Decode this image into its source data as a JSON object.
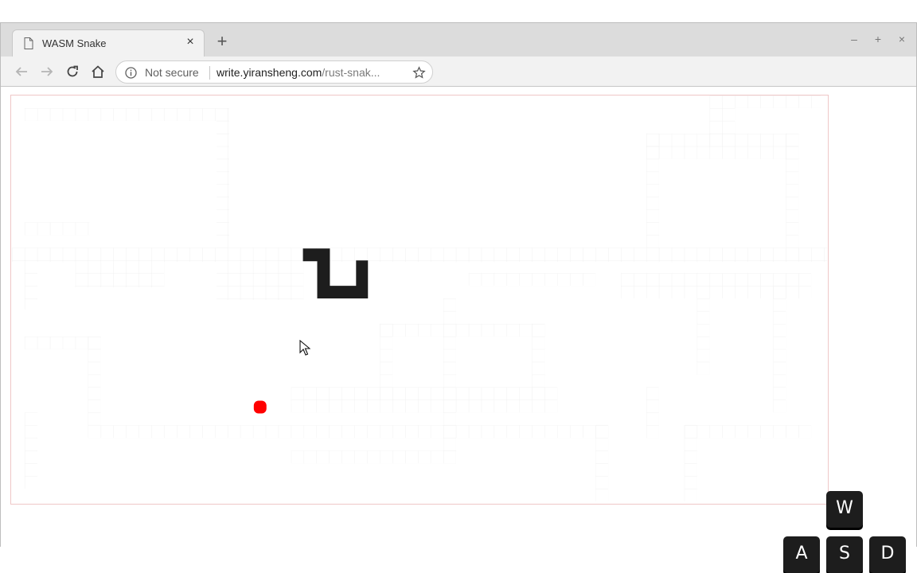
{
  "browser": {
    "tab_title": "WASM Snake",
    "new_tab_symbol": "+",
    "close_symbol": "×",
    "window_controls": {
      "minimize": "–",
      "maximize": "+",
      "close": "×"
    },
    "omnibox": {
      "security_label": "Not secure",
      "url_host": "write.yiransheng.com",
      "url_path": "/rust-snak..."
    },
    "icons": [
      "page-icon",
      "back-arrow-icon",
      "forward-arrow-icon",
      "reload-icon",
      "home-icon",
      "info-icon",
      "star-icon"
    ]
  },
  "game": {
    "board_border_color": "#efc7c7",
    "snake_color": "#1d1d1d",
    "food_color": "#ff0000",
    "controls": {
      "up": "W",
      "left": "A",
      "down": "S",
      "right": "D"
    }
  }
}
